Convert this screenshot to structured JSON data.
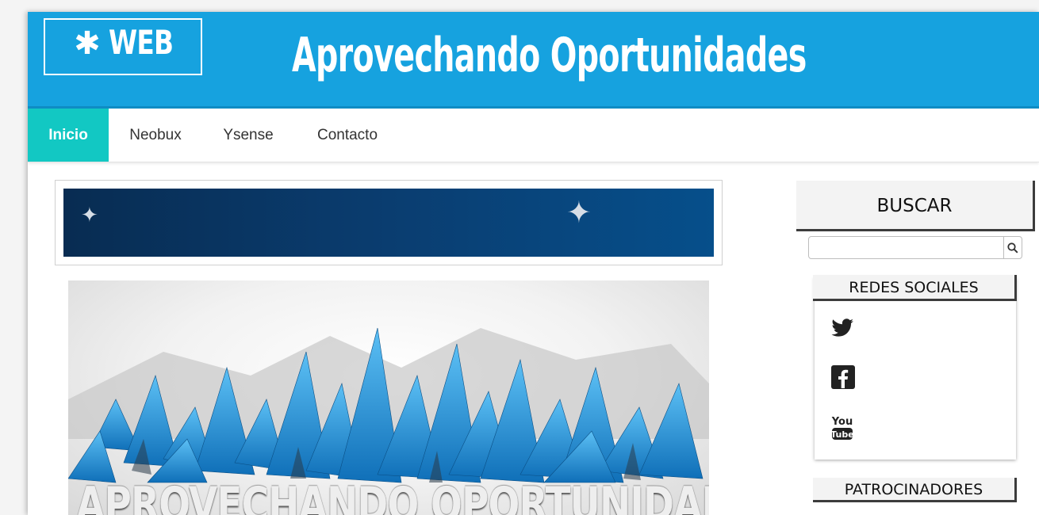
{
  "header": {
    "logo_text": "WEB",
    "logo_icon": "gear-icon",
    "site_title": "Aprovechando Oportunidades",
    "background_color": "#16a2df"
  },
  "nav": {
    "items": [
      {
        "label": "Inicio",
        "active": true
      },
      {
        "label": "Neobux",
        "active": false
      },
      {
        "label": "Ysense",
        "active": false
      },
      {
        "label": "Contacto",
        "active": false
      }
    ],
    "active_color": "#12c8c3"
  },
  "main": {
    "banner_color": "#0a3d70",
    "hero_text": "APROVECHANDO OPORTUNIDADES"
  },
  "sidebar": {
    "search_title": "BUSCAR",
    "search_value": "",
    "search_icon": "search-icon",
    "social_title": "REDES SOCIALES",
    "social_links": [
      {
        "icon": "twitter-icon"
      },
      {
        "icon": "facebook-icon"
      },
      {
        "icon": "youtube-icon"
      }
    ],
    "sponsors_title": "PATROCINADORES"
  }
}
